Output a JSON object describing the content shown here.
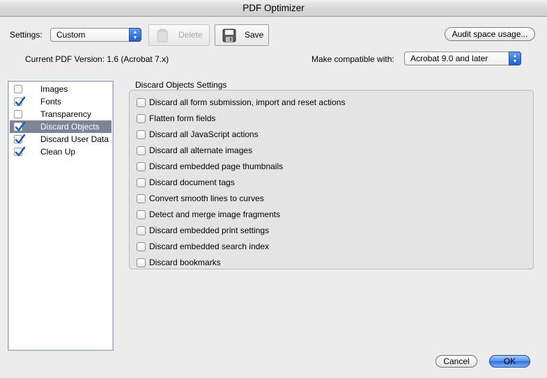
{
  "window": {
    "title": "PDF Optimizer"
  },
  "settings": {
    "label": "Settings:",
    "value": "Custom",
    "delete_label": "Delete",
    "save_label": "Save",
    "audit_label": "Audit space usage..."
  },
  "version": {
    "current": "Current PDF Version: 1.6 (Acrobat 7.x)",
    "compat_label": "Make compatible with:",
    "compat_value": "Acrobat 9.0 and later"
  },
  "sidebar": {
    "items": [
      {
        "label": "Images",
        "checked": false,
        "selected": false
      },
      {
        "label": "Fonts",
        "checked": true,
        "selected": false
      },
      {
        "label": "Transparency",
        "checked": false,
        "selected": false
      },
      {
        "label": "Discard Objects",
        "checked": true,
        "selected": true
      },
      {
        "label": "Discard User Data",
        "checked": true,
        "selected": false
      },
      {
        "label": "Clean Up",
        "checked": true,
        "selected": false
      }
    ]
  },
  "panel": {
    "title": "Discard Objects Settings",
    "options": [
      {
        "label": "Discard all form submission, import and reset actions",
        "checked": false
      },
      {
        "label": "Flatten form fields",
        "checked": false
      },
      {
        "label": "Discard all JavaScript actions",
        "checked": false
      },
      {
        "label": "Discard all alternate images",
        "checked": false
      },
      {
        "label": "Discard embedded page thumbnails",
        "checked": false
      },
      {
        "label": "Discard document tags",
        "checked": false
      },
      {
        "label": "Convert smooth lines to curves",
        "checked": false
      },
      {
        "label": "Detect and merge image fragments",
        "checked": false
      },
      {
        "label": "Discard embedded print settings",
        "checked": false
      },
      {
        "label": "Discard embedded search index",
        "checked": false
      },
      {
        "label": "Discard bookmarks",
        "checked": false
      }
    ]
  },
  "footer": {
    "cancel_label": "Cancel",
    "ok_label": "OK"
  },
  "colors": {
    "accent": "#2a6ee0",
    "selection": "#7b8597",
    "check": "#1d5fb8"
  }
}
